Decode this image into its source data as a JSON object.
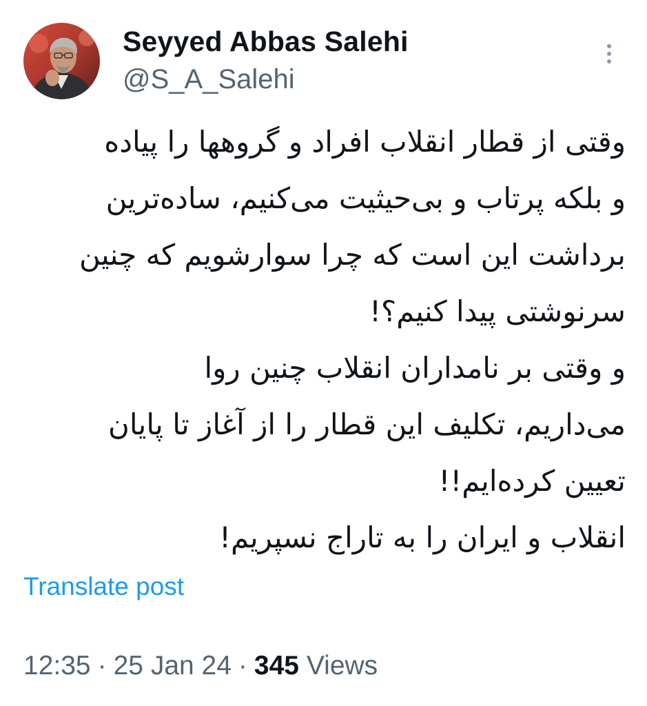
{
  "author": {
    "display_name": "Seyyed Abbas Salehi",
    "handle": "@S_A_Salehi",
    "avatar_icon": "profile-photo"
  },
  "post": {
    "text_lines": [
      "وقتی از قطار انقلاب افراد و گروهها را پیاده",
      "و بلکه پرتاب و بی‌حیثیت می‌کنیم، ساده‌ترین",
      "برداشت این است که چرا سوارشویم که چنین",
      "سرنوشتی پیدا کنیم؟!",
      "و وقتی بر نامداران انقلاب چنین روا",
      "می‌داریم، تکلیف این قطار را از آغاز تا پایان",
      "تعیین کرده‌ایم!!",
      "انقلاب و ایران را به تاراج نسپریم!"
    ],
    "translate_label": "Translate post"
  },
  "meta": {
    "time": "12:35",
    "separator": "·",
    "date": "25 Jan 24",
    "views_count": "345",
    "views_label": "Views"
  },
  "menu": {
    "more_icon": "more-vertical-icon"
  },
  "colors": {
    "text_primary": "#0f1419",
    "text_secondary": "#536471",
    "link": "#1d9bf0",
    "background": "#ffffff"
  }
}
